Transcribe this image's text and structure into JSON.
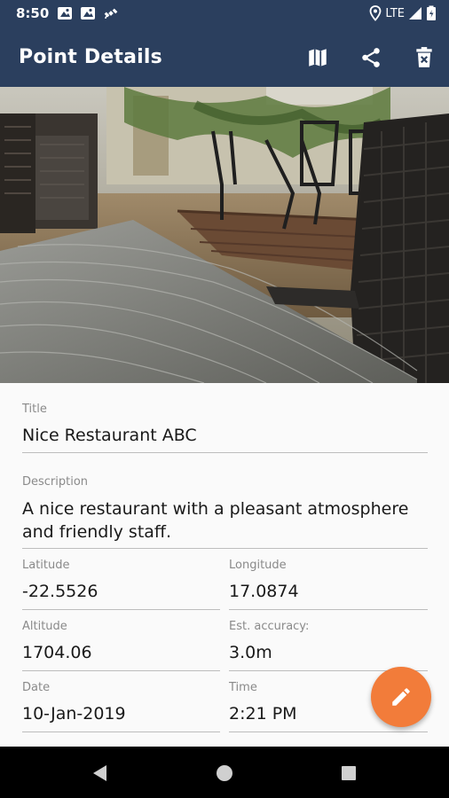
{
  "status_bar": {
    "time": "8:50",
    "network": "LTE",
    "notification_icons": [
      "map-notification-icon",
      "map-notification-icon",
      "satellite-icon"
    ],
    "right_icons": [
      "location-icon",
      "signal-icon",
      "battery-icon"
    ]
  },
  "app_bar": {
    "title": "Point Details",
    "actions": [
      "map-icon",
      "share-icon",
      "delete-icon"
    ],
    "color": "#2b3f5e"
  },
  "photo": {
    "description_icon": "restaurant-patio-photo"
  },
  "fields": {
    "title": {
      "label": "Title",
      "value": "Nice Restaurant ABC"
    },
    "description": {
      "label": "Description",
      "value": "A nice restaurant with a pleasant atmosphere and friendly staff."
    },
    "latitude": {
      "label": "Latitude",
      "value": "-22.5526"
    },
    "longitude": {
      "label": "Longitude",
      "value": "17.0874"
    },
    "altitude": {
      "label": "Altitude",
      "value": "1704.06"
    },
    "accuracy": {
      "label": "Est. accuracy:",
      "value": "3.0m"
    },
    "date": {
      "label": "Date",
      "value": "10-Jan-2019"
    },
    "time": {
      "label": "Time",
      "value": "2:21 PM"
    }
  },
  "fab": {
    "icon": "edit-pencil-icon",
    "color": "#f27c3a"
  },
  "nav_bar": {
    "buttons": [
      "back-icon",
      "home-icon",
      "recents-icon"
    ]
  }
}
